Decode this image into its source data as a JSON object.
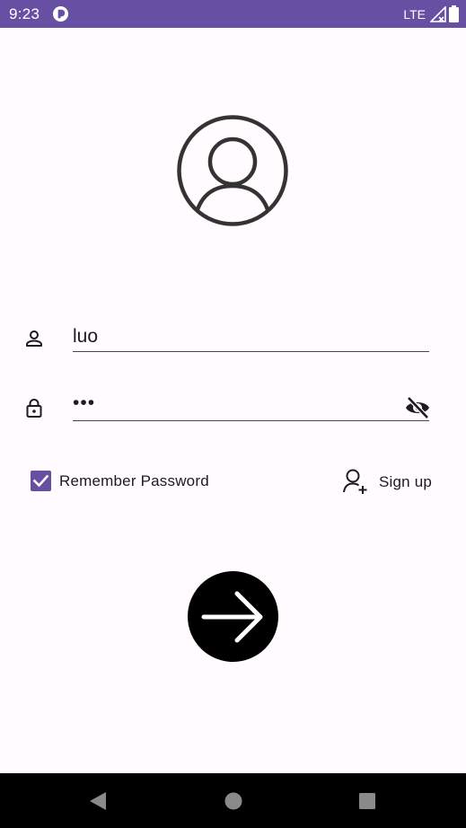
{
  "status_bar": {
    "time": "9:23",
    "network": "LTE",
    "background_color": "#6750a4",
    "icons": [
      "app-notification-icon",
      "signal-icon",
      "battery-icon"
    ]
  },
  "login": {
    "avatar_icon": "user-circle-icon",
    "username": {
      "icon": "person-icon",
      "value": "luo"
    },
    "password": {
      "icon": "lock-icon",
      "value": "•••",
      "toggle_icon": "visibility-off-icon"
    },
    "remember": {
      "label": "Remember Password",
      "checked": true,
      "accent_color": "#6750a4"
    },
    "signup": {
      "icon": "person-add-icon",
      "label": "Sign up"
    },
    "submit": {
      "icon": "arrow-right-icon",
      "color": "#000000"
    }
  },
  "nav_bar": {
    "buttons": [
      "back-icon",
      "home-icon",
      "recents-icon"
    ]
  }
}
